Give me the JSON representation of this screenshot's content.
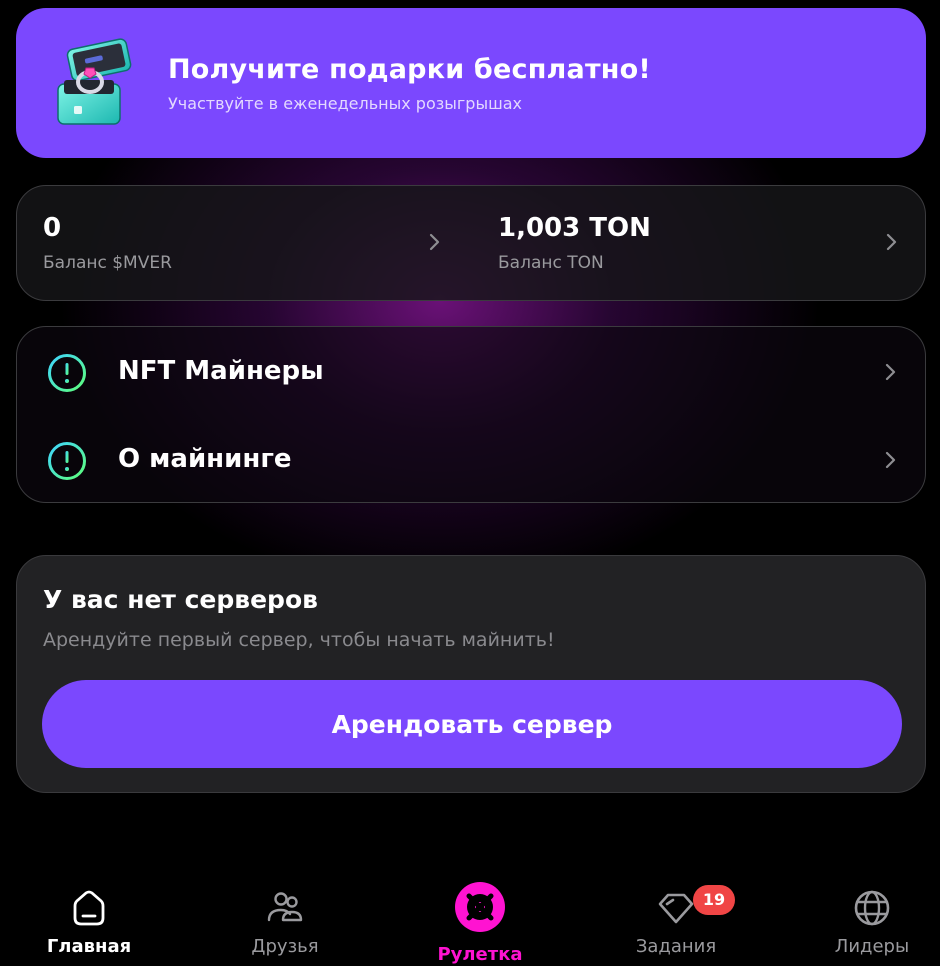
{
  "promo": {
    "title": "Получите подарки бесплатно!",
    "subtitle": "Участвуйте в еженедельных розыгрышах",
    "icon": "gift-ring-box-icon",
    "color": "#7b48fe"
  },
  "balances": [
    {
      "value": "0",
      "label": "Баланс $MVER"
    },
    {
      "value": "1,003 TON",
      "label": "Баланс TON"
    }
  ],
  "menu": [
    {
      "label": "NFT Майнеры",
      "icon": "info-icon"
    },
    {
      "label": "О майнинге",
      "icon": "info-icon"
    }
  ],
  "servers": {
    "title": "У вас нет серверов",
    "description": "Арендуйте первый сервер, чтобы начать майнить!",
    "button": "Арендовать сервер"
  },
  "nav": {
    "items": [
      {
        "label": "Главная",
        "icon": "home-icon",
        "active": true
      },
      {
        "label": "Друзья",
        "icon": "friends-icon"
      },
      {
        "label": "Рулетка",
        "icon": "roulette-icon",
        "accent": "#ff13d1"
      },
      {
        "label": "Задания",
        "icon": "diamond-icon",
        "badge": "19"
      },
      {
        "label": "Лидеры",
        "icon": "globe-icon"
      }
    ]
  },
  "colors": {
    "accent": "#7b48fe",
    "roulette": "#ff13d1",
    "badge": "#f04545",
    "info_gradient_start": "#3fd5ff",
    "info_gradient_end": "#5dff7a"
  }
}
